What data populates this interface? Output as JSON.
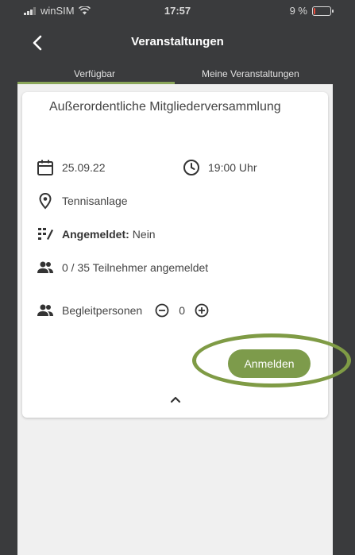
{
  "status_bar": {
    "carrier": "winSIM",
    "time": "17:57",
    "battery": "9 %",
    "battery_level": 0.09
  },
  "header": {
    "title": "Veranstaltungen"
  },
  "tabs": [
    {
      "label": "Verfügbar",
      "active": true
    },
    {
      "label": "Meine Veranstaltungen",
      "active": false
    }
  ],
  "event": {
    "title": "Außerordentliche Mitgliederversammlung",
    "date": "25.09.22",
    "time": "19:00 Uhr",
    "location": "Tennisanlage",
    "registered_label": "Angemeldet:",
    "registered_value": "Nein",
    "participants": "0 / 35 Teilnehmer angemeldet",
    "companions_label": "Begleitpersonen",
    "companions_count": "0",
    "register_button": "Anmelden"
  },
  "colors": {
    "accent": "#7d9b4b",
    "background": "#3a3b3d",
    "ring": "#7f9b45"
  }
}
